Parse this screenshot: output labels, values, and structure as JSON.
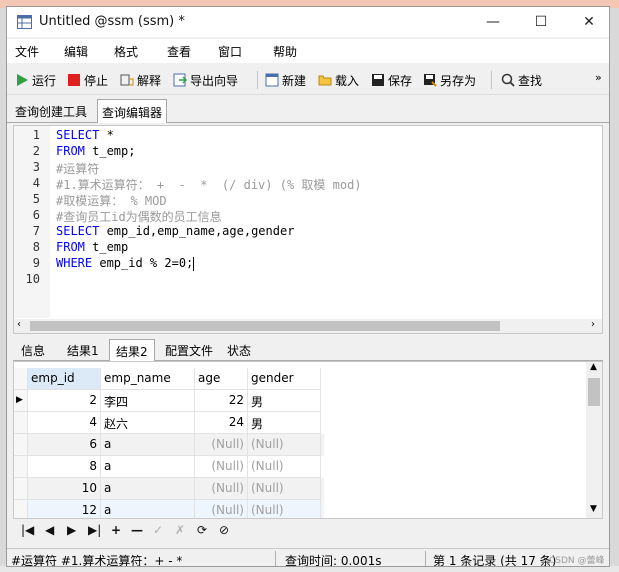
{
  "window": {
    "title": "Untitled @ssm (ssm) *",
    "minimize": "—",
    "maximize": "☐",
    "close": "✕"
  },
  "menu": [
    "文件",
    "编辑",
    "格式",
    "查看",
    "窗口",
    "帮助"
  ],
  "toolbar": {
    "run": "运行",
    "stop": "停止",
    "explain": "解释",
    "export": "导出向导",
    "new": "新建",
    "load": "载入",
    "save": "保存",
    "saveas": "另存为",
    "find": "查找",
    "more": "»"
  },
  "editor_tabs": [
    "查询创建工具",
    "查询编辑器"
  ],
  "code": {
    "line_numbers": [
      "1",
      "2",
      "3",
      "4",
      "5",
      "6",
      "7",
      "8",
      "9",
      "10"
    ],
    "l1k": "SELECT",
    "l1t": " *",
    "l2k": "FROM",
    "l2t": " t_emp;",
    "l3": "#运算符",
    "l4": "#1.算术运算符： +  -  *  (/ div) (% 取模 mod)",
    "l5": "#取模运算： % MOD",
    "l6": "#查询员工id为偶数的员工信息",
    "l7k": "SELECT",
    "l7t": " emp_id,emp_name,age,gender",
    "l8k": "FROM",
    "l8t": " t_emp",
    "l9k": "WHERE",
    "l9t": " emp_id % 2=0;"
  },
  "result_tabs": [
    "信息",
    "结果1",
    "结果2",
    "配置文件",
    "状态"
  ],
  "table": {
    "headers": [
      "emp_id",
      "emp_name",
      "age",
      "gender"
    ],
    "rows": [
      [
        "2",
        "李四",
        "22",
        "男"
      ],
      [
        "4",
        "赵六",
        "24",
        "男"
      ],
      [
        "6",
        "a",
        "(Null)",
        "(Null)"
      ],
      [
        "8",
        "a",
        "(Null)",
        "(Null)"
      ],
      [
        "10",
        "a",
        "(Null)",
        "(Null)"
      ],
      [
        "12",
        "a",
        "(Null)",
        "(Null)"
      ]
    ]
  },
  "nav_buttons": [
    "|◀",
    "◀",
    "▶",
    "▶|",
    "+",
    "—",
    "✓",
    "✗",
    "⟳",
    "⊘"
  ],
  "status": {
    "sql": "#运算符 #1.算术运算符：+  -  *",
    "time": "查询时间: 0.001s",
    "records": "第 1 条记录 (共 17 条)",
    "watermark": "CSDN @蕾峰"
  },
  "colors": {
    "keyword": "#0000ff",
    "comment": "#9a9a9a",
    "null": "#a0a0a0",
    "selected_header": "#dceaf8"
  }
}
